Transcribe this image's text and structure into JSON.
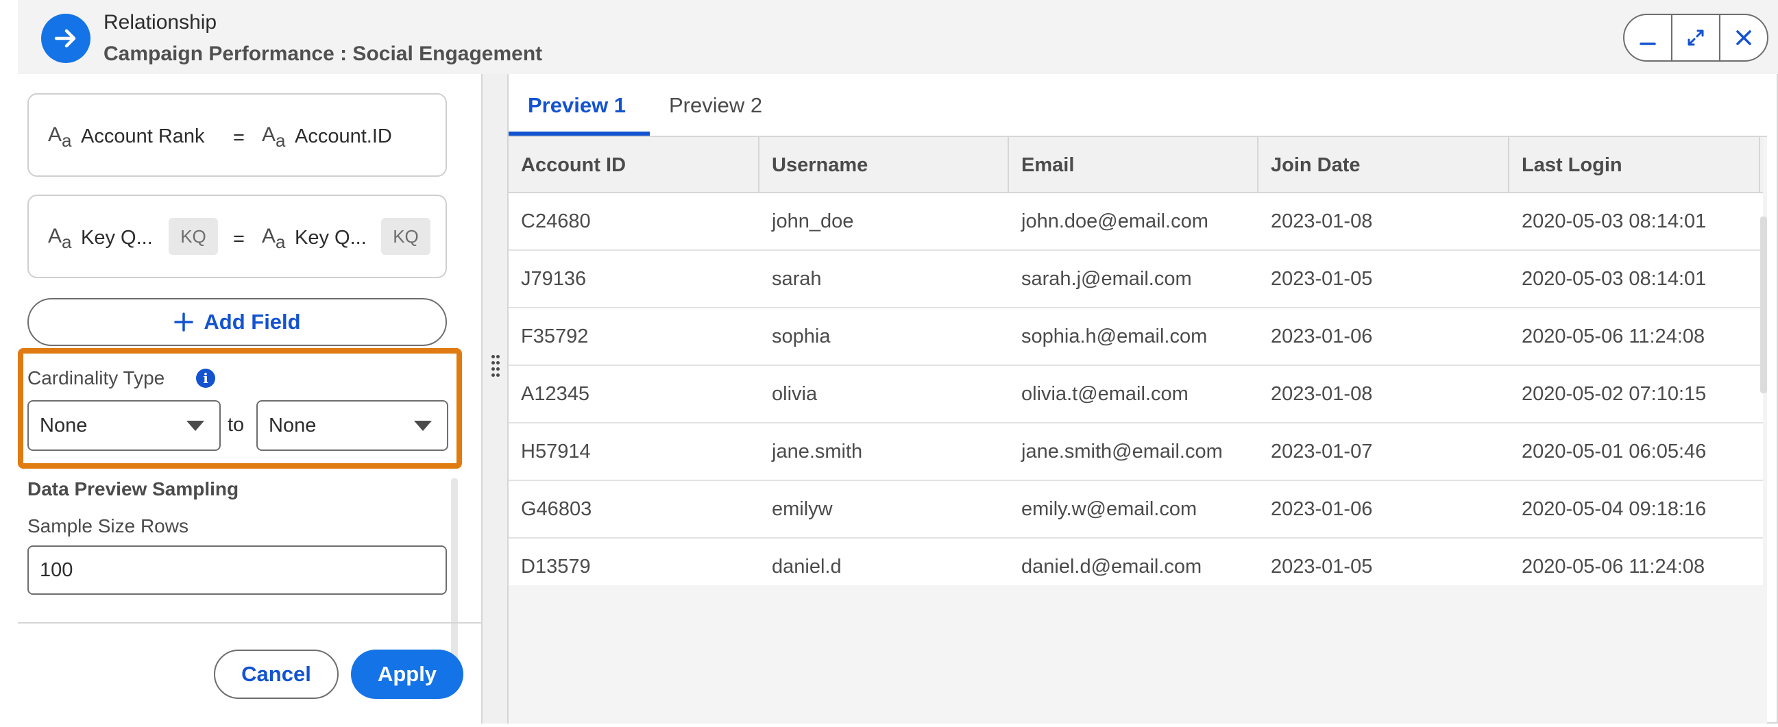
{
  "header": {
    "title": "Relationship",
    "subtitle": "Campaign Performance : Social Engagement"
  },
  "mappings": [
    {
      "left_field": "Account Rank",
      "right_field": "Account.ID"
    },
    {
      "left_field": "Key Q...",
      "left_badge": "KQ",
      "right_field": "Key Q...",
      "right_badge": "KQ"
    }
  ],
  "equals": "=",
  "type_icon_label": {
    "big": "A",
    "small": "a"
  },
  "add_field_label": "Add Field",
  "cardinality": {
    "label": "Cardinality Type",
    "info_glyph": "i",
    "left_value": "None",
    "to_label": "to",
    "right_value": "None"
  },
  "sampling": {
    "title": "Data Preview Sampling",
    "size_label": "Sample Size Rows",
    "size_value": "100"
  },
  "buttons": {
    "cancel": "Cancel",
    "apply": "Apply"
  },
  "tabs": [
    {
      "label": "Preview 1",
      "active": true
    },
    {
      "label": "Preview 2",
      "active": false
    }
  ],
  "table": {
    "columns": [
      "Account ID",
      "Username",
      "Email",
      "Join Date",
      "Last Login"
    ],
    "rows": [
      [
        "C24680",
        "john_doe",
        "john.doe@email.com",
        "2023-01-08",
        "2020-05-03 08:14:01"
      ],
      [
        "J79136",
        "sarah",
        "sarah.j@email.com",
        "2023-01-05",
        "2020-05-03 08:14:01"
      ],
      [
        "F35792",
        "sophia",
        "sophia.h@email.com",
        "2023-01-06",
        "2020-05-06 11:24:08"
      ],
      [
        "A12345",
        "olivia",
        "olivia.t@email.com",
        "2023-01-08",
        "2020-05-02 07:10:15"
      ],
      [
        "H57914",
        "jane.smith",
        "jane.smith@email.com",
        "2023-01-07",
        "2020-05-01 06:05:46"
      ],
      [
        "G46803",
        "emilyw",
        "emily.w@email.com",
        "2023-01-06",
        "2020-05-04 09:18:16"
      ],
      [
        "D13579",
        "daniel.d",
        "daniel.d@email.com",
        "2023-01-05",
        "2020-05-06 11:24:08"
      ]
    ]
  },
  "colors": {
    "accent": "#1473e6",
    "link": "#1353d0",
    "highlight": "#e07b12"
  },
  "icons": [
    "arrow-right-icon",
    "minimize-icon",
    "expand-icon",
    "close-icon",
    "text-type-icon",
    "info-icon",
    "plus-icon",
    "chevron-down-icon",
    "drag-handle-icon"
  ]
}
